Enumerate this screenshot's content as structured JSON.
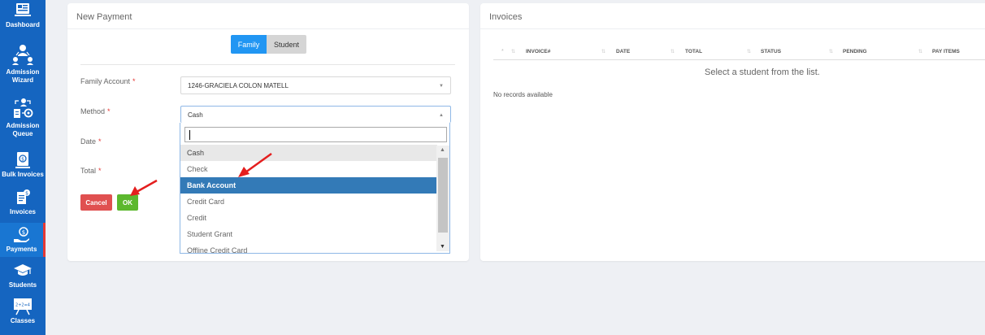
{
  "sidebar": {
    "items": [
      {
        "label": "Dashboard",
        "icon": "dashboard-icon"
      },
      {
        "label": "Admission Wizard",
        "icon": "admission-wizard-icon"
      },
      {
        "label": "Admission Queue",
        "icon": "admission-queue-icon"
      },
      {
        "label": "Bulk Invoices",
        "icon": "bulk-invoices-icon"
      },
      {
        "label": "Invoices",
        "icon": "invoices-icon"
      },
      {
        "label": "Payments",
        "icon": "payments-icon",
        "active": true
      },
      {
        "label": "Students",
        "icon": "graduation-cap-icon"
      },
      {
        "label": "Classes",
        "icon": "classes-board-icon"
      }
    ]
  },
  "new_payment": {
    "title": "New Payment",
    "toggle": {
      "family": "Family",
      "student": "Student",
      "selected": "Family"
    },
    "fields": {
      "family_account": {
        "label": "Family Account",
        "value": "1246-GRACIELA COLON MATELL"
      },
      "method": {
        "label": "Method",
        "value": "Cash"
      },
      "date": {
        "label": "Date"
      },
      "total": {
        "label": "Total"
      }
    },
    "required_mark": "*",
    "buttons": {
      "cancel": "Cancel",
      "ok": "OK"
    }
  },
  "method_dropdown": {
    "search_value": "",
    "options": [
      "Cash",
      "Check",
      "Bank Account",
      "Credit Card",
      "Credit",
      "Student Grant",
      "Offline Credit Card"
    ],
    "selected": "Cash",
    "highlighted": "Bank Account"
  },
  "invoices": {
    "title": "Invoices",
    "columns": [
      "INVOICE#",
      "DATE",
      "TOTAL",
      "STATUS",
      "PENDING",
      "PAY ITEMS"
    ],
    "empty_message": "Select a student from the list.",
    "no_records": "No records available"
  },
  "colors": {
    "sidebar": "#1565c0",
    "primary": "#2196f3",
    "highlight": "#337ab7",
    "cancel": "#e05050",
    "ok": "#5cb82e",
    "annotation_arrow": "#e41e1e"
  }
}
